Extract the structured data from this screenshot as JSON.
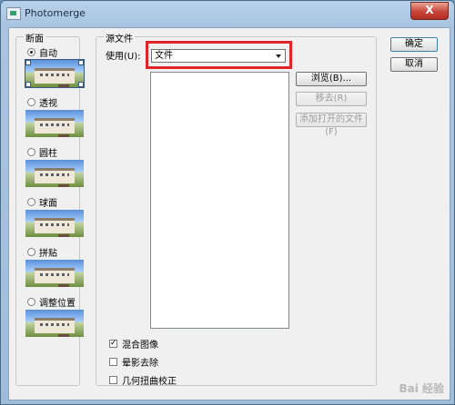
{
  "window": {
    "title": "Photomerge",
    "close_glyph": "X"
  },
  "layout": {
    "group_label": "断面",
    "options": [
      {
        "label": "自动",
        "selected": true
      },
      {
        "label": "透视",
        "selected": false
      },
      {
        "label": "圆柱",
        "selected": false
      },
      {
        "label": "球面",
        "selected": false
      },
      {
        "label": "拼贴",
        "selected": false
      },
      {
        "label": "调整位置",
        "selected": false
      }
    ]
  },
  "source": {
    "group_label": "源文件",
    "use_label": "使用(U):",
    "use_value": "文件",
    "buttons": {
      "browse": "浏览(B)...",
      "remove": "移去(R)",
      "add_open": "添加打开的文件(F)"
    },
    "checkboxes": [
      {
        "label": "混合图像",
        "checked": true
      },
      {
        "label": "晕影去除",
        "checked": false
      },
      {
        "label": "几何扭曲校正",
        "checked": false
      }
    ]
  },
  "actions": {
    "ok": "确定",
    "cancel": "取消"
  },
  "watermark": "Bai 经验",
  "colors": {
    "highlight": "#e0242a",
    "titlebar": "#b9d1ea",
    "close": "#c7463a"
  }
}
